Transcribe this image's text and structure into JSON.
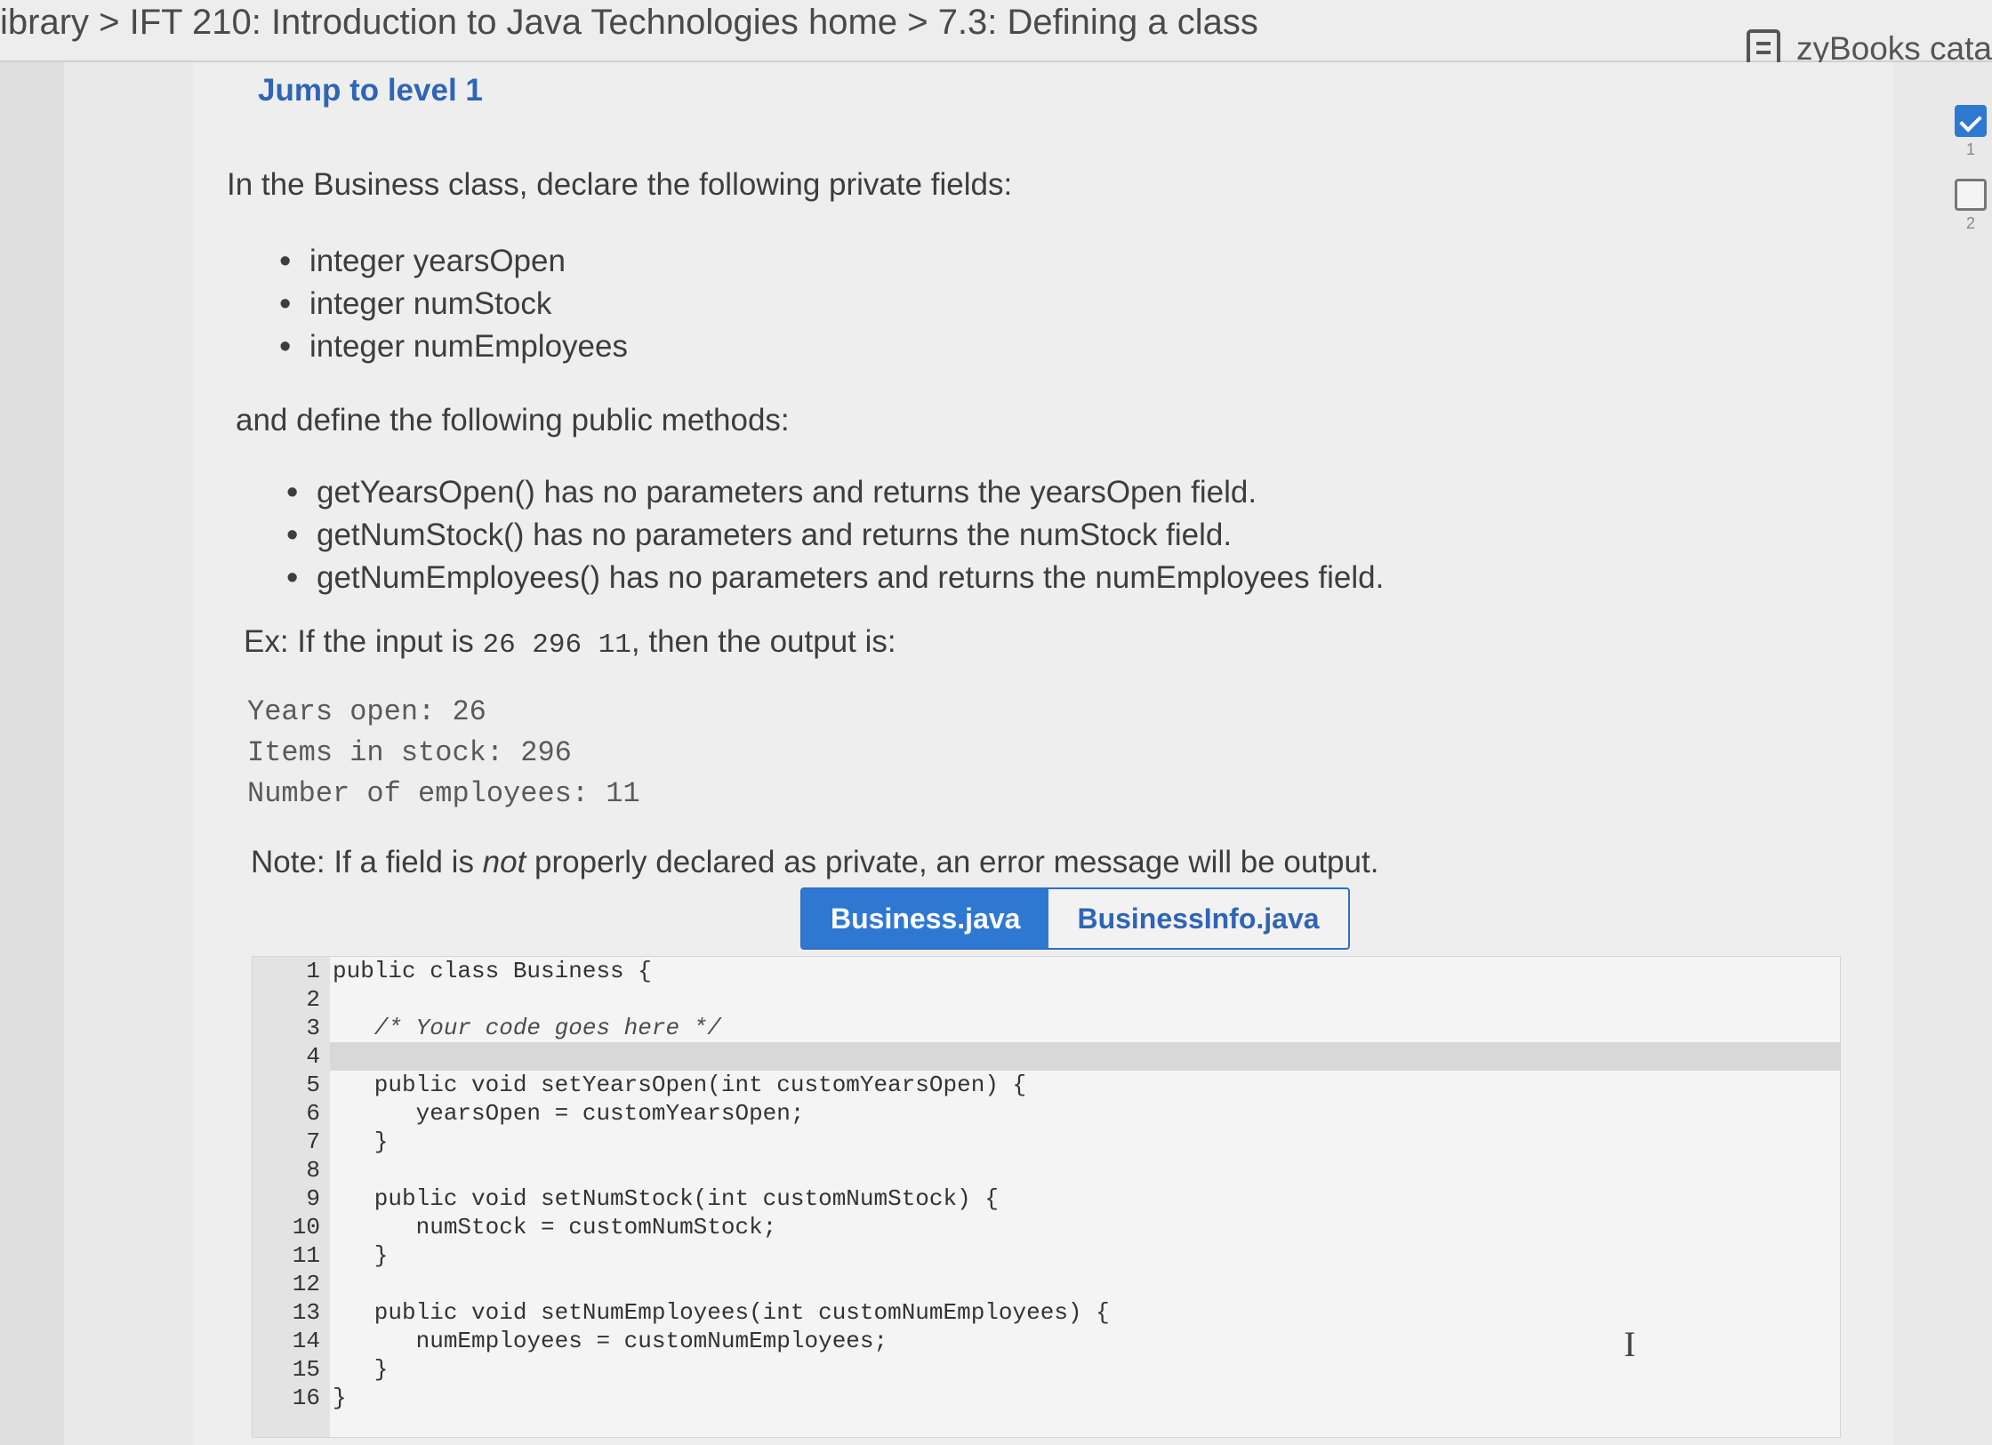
{
  "breadcrumb": "ibrary > IFT 210: Introduction to Java Technologies home > 7.3: Defining a class",
  "catalog_label": "zyBooks cata",
  "jump_label": "Jump to level 1",
  "intro": "In the Business class, declare the following private fields:",
  "fields": [
    "integer yearsOpen",
    "integer numStock",
    "integer numEmployees"
  ],
  "methods_intro": "and define the following public methods:",
  "methods": [
    "getYearsOpen() has no parameters and returns the yearsOpen field.",
    "getNumStock() has no parameters and returns the numStock field.",
    "getNumEmployees() has no parameters and returns the numEmployees field."
  ],
  "example": {
    "prefix": "Ex: If the input is ",
    "input": "26 296 11",
    "suffix": ", then the output is:"
  },
  "output_lines": [
    "Years open: 26",
    "Items in stock: 296",
    "Number of employees: 11"
  ],
  "note": {
    "prefix": "Note: If a field is ",
    "emphasis": "not",
    "suffix": " properly declared as private, an error message will be output."
  },
  "tabs": [
    {
      "label": "Business.java",
      "active": true
    },
    {
      "label": "BusinessInfo.java",
      "active": false
    }
  ],
  "code_lines": [
    {
      "num": "1",
      "text": "public class Business {"
    },
    {
      "num": "2",
      "text": ""
    },
    {
      "num": "3",
      "text": "   /* Your code goes here */"
    },
    {
      "num": "4",
      "text": ""
    },
    {
      "num": "5",
      "text": "   public void setYearsOpen(int customYearsOpen) {"
    },
    {
      "num": "6",
      "text": "      yearsOpen = customYearsOpen;"
    },
    {
      "num": "7",
      "text": "   }"
    },
    {
      "num": "8",
      "text": ""
    },
    {
      "num": "9",
      "text": "   public void setNumStock(int customNumStock) {"
    },
    {
      "num": "10",
      "text": "      numStock = customNumStock;"
    },
    {
      "num": "11",
      "text": "   }"
    },
    {
      "num": "12",
      "text": ""
    },
    {
      "num": "13",
      "text": "   public void setNumEmployees(int customNumEmployees) {"
    },
    {
      "num": "14",
      "text": "      numEmployees = customNumEmployees;"
    },
    {
      "num": "15",
      "text": "   }"
    },
    {
      "num": "16",
      "text": "}"
    }
  ],
  "levels": [
    {
      "label": "1",
      "done": true
    },
    {
      "label": "2",
      "done": false
    }
  ],
  "colors": {
    "accent": "#2f78d2",
    "link": "#2f64b6"
  }
}
